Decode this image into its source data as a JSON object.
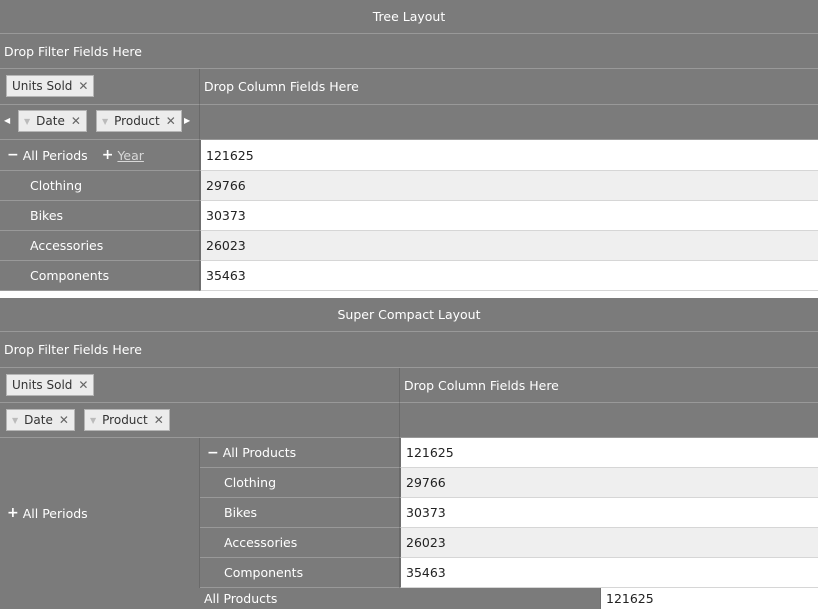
{
  "tree": {
    "title": "Tree Layout",
    "filter_zone": "Drop Filter Fields Here",
    "value_chip": "Units Sold",
    "column_zone": "Drop Column Fields Here",
    "row_chips": [
      "Date",
      "Product"
    ],
    "root_label": "All Periods",
    "expand_link": "Year",
    "total": "121625",
    "rows": [
      {
        "label": "Clothing",
        "value": "29766"
      },
      {
        "label": "Bikes",
        "value": "30373"
      },
      {
        "label": "Accessories",
        "value": "26023"
      },
      {
        "label": "Components",
        "value": "35463"
      }
    ]
  },
  "compact": {
    "title": "Super Compact Layout",
    "filter_zone": "Drop Filter Fields Here",
    "value_chip": "Units Sold",
    "column_zone": "Drop Column Fields Here",
    "row_chips": [
      "Date",
      "Product"
    ],
    "outer_label": "All Periods",
    "inner_label": "All Products",
    "total": "121625",
    "rows": [
      {
        "label": "Clothing",
        "value": "29766"
      },
      {
        "label": "Bikes",
        "value": "30373"
      },
      {
        "label": "Accessories",
        "value": "26023"
      },
      {
        "label": "Components",
        "value": "35463"
      }
    ],
    "footer_label": "All Products",
    "footer_total": "121625"
  },
  "icons": {
    "close": "✕",
    "minus": "−",
    "plus": "+",
    "left": "◀",
    "right": "▶",
    "sort": "▼"
  }
}
